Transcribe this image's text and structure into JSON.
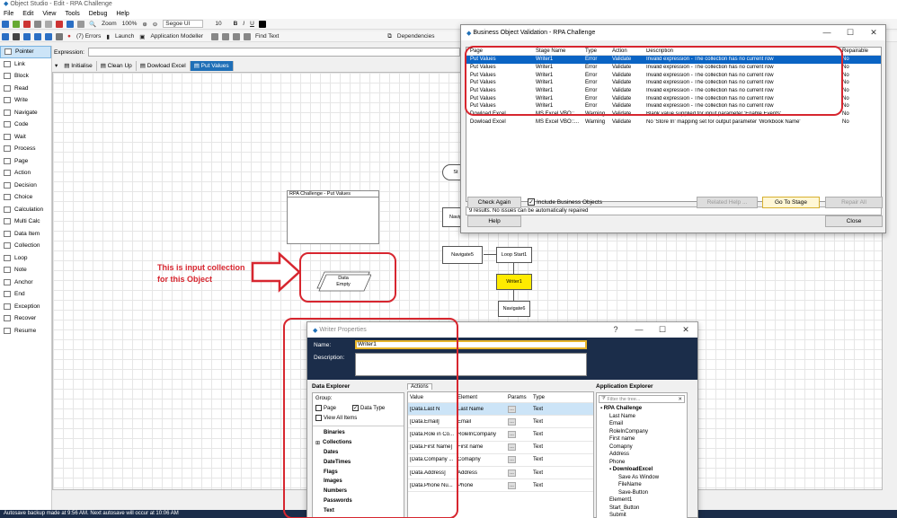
{
  "window": {
    "title": "Object Studio - Edit - RPA Challenge"
  },
  "menu": [
    "File",
    "Edit",
    "View",
    "Tools",
    "Debug",
    "Help"
  ],
  "toolbar1": {
    "zoom_label": "Zoom",
    "zoom_value": "100%",
    "font_name": "Segoe UI",
    "font_size": "10",
    "bold": "B",
    "italic": "I",
    "underline": "U"
  },
  "toolbar2": {
    "errors": "(7) Errors",
    "launch": "Launch",
    "app_modeller": "Application Modeller",
    "find_text": "Find Text",
    "dependencies": "Dependencies"
  },
  "palette": [
    "Pointer",
    "Link",
    "Block",
    "Read",
    "Write",
    "Navigate",
    "Code",
    "Wait",
    "Process",
    "Page",
    "Action",
    "Decision",
    "Choice",
    "Calculation",
    "Multi Calc",
    "Data Item",
    "Collection",
    "Loop",
    "Note",
    "Anchor",
    "End",
    "Exception",
    "Recover",
    "Resume"
  ],
  "expression_label": "Expression:",
  "page_tabs": [
    "Initialise",
    "Clean Up",
    "Dowload Excel",
    "Put Values"
  ],
  "canvas": {
    "block_title": "RPA Challenge - Put Values",
    "annotation_line1": "This is input collection",
    "annotation_line2": "for this Object",
    "data_label": "Data",
    "data_sub": "Empty",
    "stage_start": "St",
    "stage_navigate": "Navig",
    "stage_navigate5": "Navigate5",
    "stage_loopstart": "Loop Start1",
    "stage_writer1": "Writer1",
    "stage_navigate6": "Navigate6"
  },
  "validation": {
    "title": "Business Object Validation - RPA Challenge",
    "columns": [
      "Page",
      "Stage Name",
      "Type",
      "Action",
      "Description",
      "Repairable"
    ],
    "rows": [
      [
        "Put Values",
        "Writer1",
        "Error",
        "Validate",
        "Invalid expression - The collection has no current row",
        "No"
      ],
      [
        "Put Values",
        "Writer1",
        "Error",
        "Validate",
        "Invalid expression - The collection has no current row",
        "No"
      ],
      [
        "Put Values",
        "Writer1",
        "Error",
        "Validate",
        "Invalid expression - The collection has no current row",
        "No"
      ],
      [
        "Put Values",
        "Writer1",
        "Error",
        "Validate",
        "Invalid expression - The collection has no current row",
        "No"
      ],
      [
        "Put Values",
        "Writer1",
        "Error",
        "Validate",
        "Invalid expression - The collection has no current row",
        "No"
      ],
      [
        "Put Values",
        "Writer1",
        "Error",
        "Validate",
        "Invalid expression - The collection has no current row",
        "No"
      ],
      [
        "Put Values",
        "Writer1",
        "Error",
        "Validate",
        "Invalid expression - The collection has no current row",
        "No"
      ],
      [
        "Dowload Excel",
        "MS Excel VBO::...",
        "Warning",
        "Validate",
        "Blank value supplied for input parameter 'Enable Events'",
        "No"
      ],
      [
        "Dowload Excel",
        "MS Excel VBO::...",
        "Warning",
        "Validate",
        "No 'Store In' mapping set for output parameter 'Workbook Name'",
        "No"
      ]
    ],
    "status": "9 results. No issues can be automatically repaired",
    "check_again": "Check Again",
    "include_bo": "Include Business Objects",
    "related_help": "Related Help ...",
    "go_to_stage": "Go To Stage",
    "repair_all": "Repair All",
    "help": "Help",
    "close": "Close"
  },
  "writer": {
    "title": "Writer Properties",
    "name_label": "Name:",
    "name_value": "Writer1",
    "description_label": "Description:",
    "data_explorer": "Data Explorer",
    "group_label": "Group:",
    "page_label": "Page",
    "data_type_label": "Data Type",
    "view_all": "View All Items",
    "data_types": [
      "Binaries",
      "Collections",
      "Dates",
      "DateTimes",
      "Flags",
      "Images",
      "Numbers",
      "Passwords",
      "Text"
    ],
    "actions_tab": "Actions",
    "columns": [
      "Value",
      "Element",
      "Params",
      "Type"
    ],
    "rows": [
      [
        "[Data.Last N",
        "Last Name",
        "",
        "Text"
      ],
      [
        "[Data.Email]",
        "Email",
        "",
        "Text"
      ],
      [
        "[Data.Role in Co...",
        "RoleInCompany",
        "",
        "Text"
      ],
      [
        "[Data.First Name]",
        "First name",
        "",
        "Text"
      ],
      [
        "[Data.Company ...",
        "Comapny",
        "",
        "Text"
      ],
      [
        "[Data.Address]",
        "Address",
        "",
        "Text"
      ],
      [
        "[Data.Phone  Nu...",
        "Phone",
        "",
        "Text"
      ]
    ],
    "app_explorer": "Application Explorer",
    "filter_placeholder": "Filter the tree...",
    "tree": [
      {
        "label": "RPA Challenge",
        "level": 0,
        "bold": true
      },
      {
        "label": "Last Name",
        "level": 1
      },
      {
        "label": "Email",
        "level": 1
      },
      {
        "label": "RoleInCompany",
        "level": 1
      },
      {
        "label": "First name",
        "level": 1
      },
      {
        "label": "Comapny",
        "level": 1
      },
      {
        "label": "Address",
        "level": 1
      },
      {
        "label": "Phone",
        "level": 1
      },
      {
        "label": "DownloadExcel",
        "level": 1,
        "bold": true
      },
      {
        "label": "Save As Window",
        "level": 2
      },
      {
        "label": "FileName",
        "level": 2
      },
      {
        "label": "Save-Button",
        "level": 2
      },
      {
        "label": "Element1",
        "level": 1
      },
      {
        "label": "Start_Button",
        "level": 1
      },
      {
        "label": "Submit",
        "level": 1
      }
    ]
  },
  "status_bar": "Autosave backup made at 9:56 AM. Next autosave will occur at 10:06 AM",
  "colors": {
    "accent_blue": "#1f6fb7",
    "dialog_header": "#1b2d4a",
    "annotation_red": "#d7262f",
    "selected_row": "#0a64c4"
  }
}
